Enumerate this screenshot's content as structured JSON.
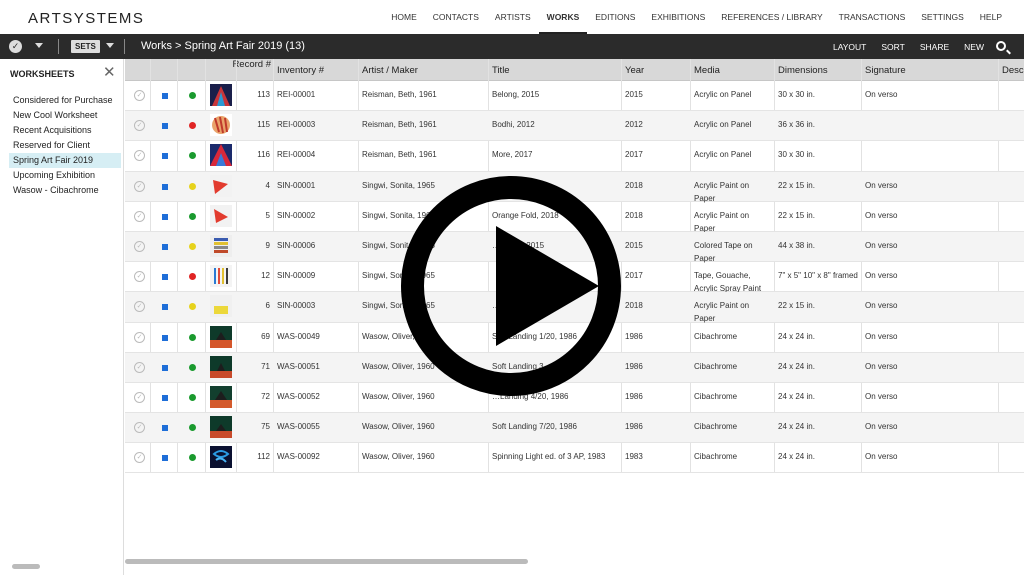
{
  "app": {
    "logo": "ARTSYSTEMS"
  },
  "nav": {
    "items": [
      "HOME",
      "CONTACTS",
      "ARTISTS",
      "WORKS",
      "EDITIONS",
      "EXHIBITIONS",
      "REFERENCES / LIBRARY",
      "TRANSACTIONS",
      "SETTINGS",
      "HELP"
    ],
    "active": "WORKS"
  },
  "toolbar": {
    "sets_label": "SETS",
    "breadcrumb": "Works > Spring Art Fair 2019 (13)",
    "actions": [
      "LAYOUT",
      "SORT",
      "SHARE",
      "NEW"
    ]
  },
  "sidebar": {
    "title": "WORKSHEETS",
    "items": [
      "Considered for Purchase",
      "New Cool Worksheet",
      "Recent Acquisitions",
      "Reserved for Client",
      "Spring Art Fair 2019",
      "Upcoming Exhibition",
      "Wasow - Cibachrome"
    ],
    "active": "Spring Art Fair 2019"
  },
  "table": {
    "columns": {
      "record": "Record #",
      "inventory": "Inventory #",
      "artist": "Artist / Maker",
      "title": "Title",
      "year": "Year",
      "media": "Media",
      "dimensions": "Dimensions",
      "signature": "Signature",
      "desc": "Desc"
    },
    "status_colors": {
      "green": "#1a9a2e",
      "red": "#e02424",
      "yellow": "#e6d21c"
    },
    "rows": [
      {
        "record": "113",
        "inventory": "REI-00001",
        "artist": "Reisman, Beth, 1961",
        "title": "Belong, 2015",
        "year": "2015",
        "media": "Acrylic on Panel",
        "dimensions": "30 x 30 in.",
        "signature": "On verso",
        "status": "green"
      },
      {
        "record": "115",
        "inventory": "REI-00003",
        "artist": "Reisman, Beth, 1961",
        "title": "Bodhi, 2012",
        "year": "2012",
        "media": "Acrylic on Panel",
        "dimensions": "36 x 36 in.",
        "signature": "",
        "status": "red"
      },
      {
        "record": "116",
        "inventory": "REI-00004",
        "artist": "Reisman, Beth, 1961",
        "title": "More, 2017",
        "year": "2017",
        "media": "Acrylic on Panel",
        "dimensions": "30 x 30 in.",
        "signature": "",
        "status": "green"
      },
      {
        "record": "4",
        "inventory": "SIN-00001",
        "artist": "Singwi, Sonita, 1965",
        "title": "…2018",
        "year": "2018",
        "media": "Acrylic Paint on Paper",
        "dimensions": "22 x 15 in.",
        "signature": "On verso",
        "status": "yellow"
      },
      {
        "record": "5",
        "inventory": "SIN-00002",
        "artist": "Singwi, Sonita, 1965",
        "title": "Orange Fold, 2018",
        "year": "2018",
        "media": "Acrylic Paint on Paper",
        "dimensions": "22 x 15 in.",
        "signature": "On verso",
        "status": "green"
      },
      {
        "record": "9",
        "inventory": "SIN-00006",
        "artist": "Singwi, Sonita, 1965",
        "title": "…gnal 2, 2015",
        "year": "2015",
        "media": "Colored Tape on Paper",
        "dimensions": "44 x 38 in.",
        "signature": "On verso",
        "status": "yellow"
      },
      {
        "record": "12",
        "inventory": "SIN-00009",
        "artist": "Singwi, Sonita, 1965",
        "title": "",
        "year": "2017",
        "media": "Tape, Gouache, Acrylic Spray Paint",
        "dimensions": "7\" x 5\" 10\" x 8\" framed",
        "signature": "On verso",
        "status": "red"
      },
      {
        "record": "6",
        "inventory": "SIN-00003",
        "artist": "Singwi, Sonita, 1965",
        "title": "…8",
        "year": "2018",
        "media": "Acrylic Paint on Paper",
        "dimensions": "22 x 15 in.",
        "signature": "On verso",
        "status": "yellow"
      },
      {
        "record": "69",
        "inventory": "WAS-00049",
        "artist": "Wasow, Oliver, 1960",
        "title": "Soft Landing 1/20, 1986",
        "year": "1986",
        "media": "Cibachrome",
        "dimensions": "24 x 24 in.",
        "signature": "On verso",
        "status": "green"
      },
      {
        "record": "71",
        "inventory": "WAS-00051",
        "artist": "Wasow, Oliver, 1960",
        "title": "Soft Landing 3…",
        "year": "1986",
        "media": "Cibachrome",
        "dimensions": "24 x 24 in.",
        "signature": "On verso",
        "status": "green"
      },
      {
        "record": "72",
        "inventory": "WAS-00052",
        "artist": "Wasow, Oliver, 1960",
        "title": "…Landing 4/20, 1986",
        "year": "1986",
        "media": "Cibachrome",
        "dimensions": "24 x 24 in.",
        "signature": "On verso",
        "status": "green"
      },
      {
        "record": "75",
        "inventory": "WAS-00055",
        "artist": "Wasow, Oliver, 1960",
        "title": "Soft Landing 7/20, 1986",
        "year": "1986",
        "media": "Cibachrome",
        "dimensions": "24 x 24 in.",
        "signature": "On verso",
        "status": "green"
      },
      {
        "record": "112",
        "inventory": "WAS-00092",
        "artist": "Wasow, Oliver, 1960",
        "title": "Spinning Light ed. of 3 AP, 1983",
        "year": "1983",
        "media": "Cibachrome",
        "dimensions": "24 x 24 in.",
        "signature": "On verso",
        "status": "green"
      }
    ]
  }
}
